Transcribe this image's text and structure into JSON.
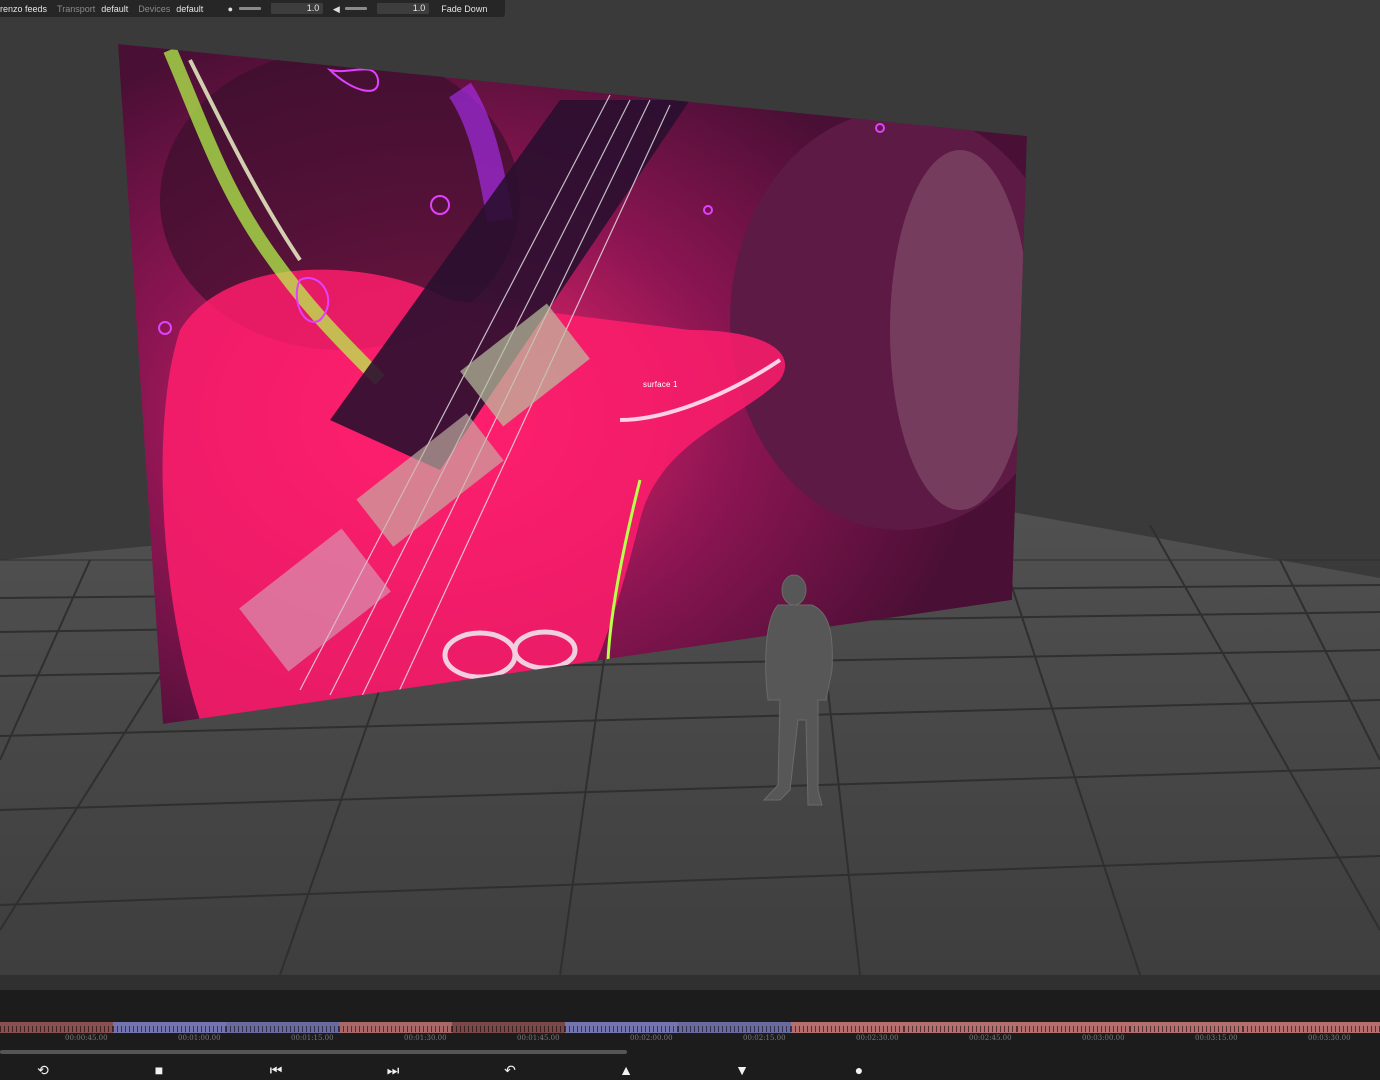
{
  "toolbar": {
    "feeds_label": "renzo feeds",
    "transport_label": "Transport",
    "transport_value": "default",
    "devices_label": "Devices",
    "devices_value": "default",
    "brightness_value": "1.0",
    "volume_value": "1.0",
    "fade_button": "Fade Down"
  },
  "scene": {
    "surface_label": "surface 1",
    "floor_color": "#444444",
    "screen_base_color": "#4a0f35",
    "accent_pink": "#ff1d6c",
    "accent_green": "#b6ff4a",
    "accent_violet": "#b030ff"
  },
  "timeline": {
    "time_labels": [
      "00:00:45.00",
      "00:01:00.00",
      "00:01:15.00",
      "00:01:30.00",
      "00:01:45.00",
      "00:02:00.00",
      "00:02:15.00",
      "00:02:30.00",
      "00:02:45.00",
      "00:03:00.00",
      "00:03:15.00",
      "00:03:30.00"
    ],
    "clip_colors": [
      "#8a5050",
      "#7474ae",
      "#6a6aa0",
      "#a86868",
      "#7a4848",
      "#7474ae",
      "#6a6aa0",
      "#b46e6e",
      "#b46e6e",
      "#b46e6e",
      "#b46e6e",
      "#b46e6e"
    ]
  },
  "transport": {
    "buttons": [
      {
        "icon": "loop-icon",
        "glyph": "⟲"
      },
      {
        "icon": "stop-icon",
        "glyph": "■"
      },
      {
        "icon": "skip-back-icon",
        "glyph": "⏮"
      },
      {
        "icon": "skip-forward-icon",
        "glyph": "⏭"
      },
      {
        "icon": "undo-icon",
        "glyph": "↶"
      },
      {
        "icon": "up-arrow-icon",
        "glyph": "▲"
      },
      {
        "icon": "down-arrow-icon",
        "glyph": "▼"
      },
      {
        "icon": "record-icon",
        "glyph": "●"
      }
    ]
  }
}
